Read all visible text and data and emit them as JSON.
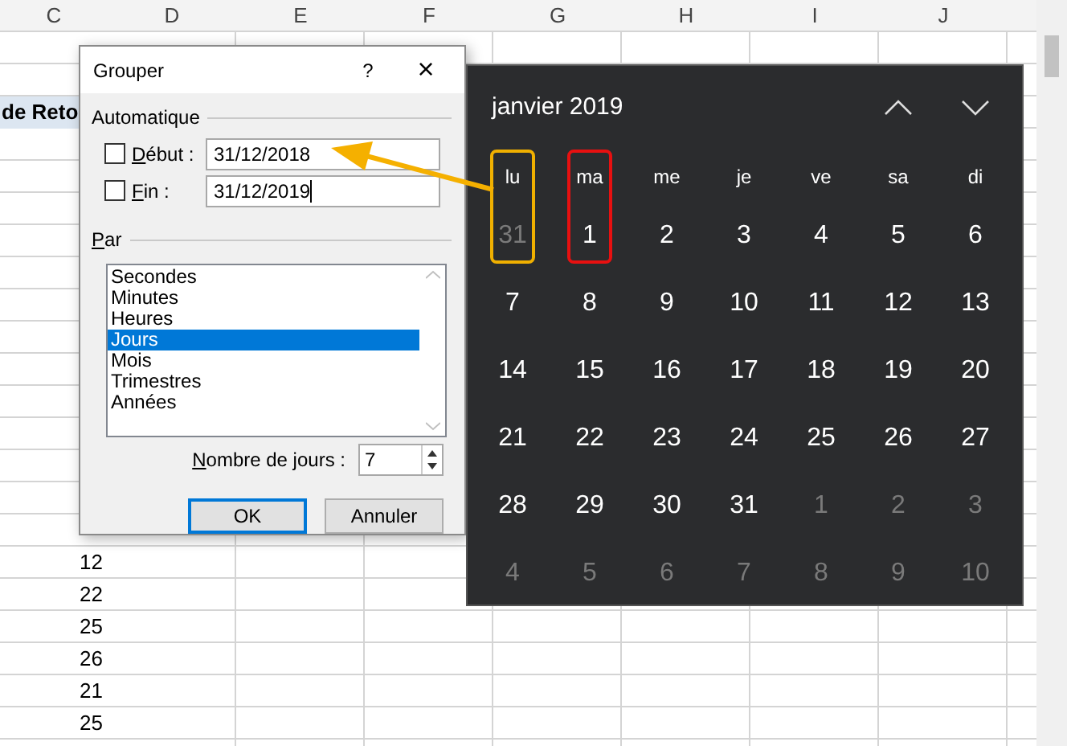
{
  "sheet": {
    "columns": [
      "C",
      "D",
      "E",
      "F",
      "G",
      "H",
      "I",
      "J"
    ],
    "rows": [
      {},
      {},
      {
        "column_c": "de Reto",
        "header_fill": true
      },
      {},
      {},
      {},
      {},
      {},
      {},
      {},
      {},
      {},
      {},
      {},
      {},
      {},
      {
        "column_c": "12"
      },
      {
        "column_c": "22"
      },
      {
        "column_c": "25"
      },
      {
        "column_c": "26"
      },
      {
        "column_c": "21"
      },
      {
        "column_c": "25"
      },
      {}
    ]
  },
  "dialog": {
    "title": "Grouper",
    "help": "?",
    "close": "×",
    "auto_group": {
      "label": "Automatique",
      "fields": [
        {
          "label": "Début :",
          "checked": false,
          "value": "31/12/2018",
          "caret": false
        },
        {
          "label": "Fin :",
          "checked": false,
          "value": "31/12/2019",
          "caret": true
        }
      ]
    },
    "by_group": {
      "label": "Par",
      "items": [
        {
          "label": "Secondes",
          "selected": false
        },
        {
          "label": "Minutes",
          "selected": false
        },
        {
          "label": "Heures",
          "selected": false
        },
        {
          "label": "Jours",
          "selected": true
        },
        {
          "label": "Mois",
          "selected": false
        },
        {
          "label": "Trimestres",
          "selected": false
        },
        {
          "label": "Années",
          "selected": false
        }
      ]
    },
    "days_count": {
      "label": "Nombre de jours :",
      "value": "7"
    },
    "buttons": [
      {
        "label": "OK",
        "default": true
      },
      {
        "label": "Annuler",
        "default": false
      }
    ]
  },
  "calendar": {
    "title": "janvier 2019",
    "weekdays": [
      {
        "label": "lu",
        "color": "#f0b000"
      },
      {
        "label": "ma",
        "color": "#e81010"
      },
      {
        "label": "me"
      },
      {
        "label": "je"
      },
      {
        "label": "ve"
      },
      {
        "label": "sa"
      },
      {
        "label": "di"
      }
    ],
    "weeks": [
      [
        {
          "label": "31",
          "in_month": false
        },
        {
          "label": "1",
          "in_month": true
        },
        {
          "label": "2",
          "in_month": true
        },
        {
          "label": "3",
          "in_month": true
        },
        {
          "label": "4",
          "in_month": true
        },
        {
          "label": "5",
          "in_month": true
        },
        {
          "label": "6",
          "in_month": true
        }
      ],
      [
        {
          "label": "7",
          "in_month": true
        },
        {
          "label": "8",
          "in_month": true
        },
        {
          "label": "9",
          "in_month": true
        },
        {
          "label": "10",
          "in_month": true
        },
        {
          "label": "11",
          "in_month": true
        },
        {
          "label": "12",
          "in_month": true
        },
        {
          "label": "13",
          "in_month": true
        }
      ],
      [
        {
          "label": "14",
          "in_month": true
        },
        {
          "label": "15",
          "in_month": true
        },
        {
          "label": "16",
          "in_month": true
        },
        {
          "label": "17",
          "in_month": true
        },
        {
          "label": "18",
          "in_month": true
        },
        {
          "label": "19",
          "in_month": true
        },
        {
          "label": "20",
          "in_month": true
        }
      ],
      [
        {
          "label": "21",
          "in_month": true
        },
        {
          "label": "22",
          "in_month": true
        },
        {
          "label": "23",
          "in_month": true
        },
        {
          "label": "24",
          "in_month": true
        },
        {
          "label": "25",
          "in_month": true
        },
        {
          "label": "26",
          "in_month": true
        },
        {
          "label": "27",
          "in_month": true
        }
      ],
      [
        {
          "label": "28",
          "in_month": true
        },
        {
          "label": "29",
          "in_month": true
        },
        {
          "label": "30",
          "in_month": true
        },
        {
          "label": "31",
          "in_month": true
        },
        {
          "label": "1",
          "in_month": false
        },
        {
          "label": "2",
          "in_month": false
        },
        {
          "label": "3",
          "in_month": false
        }
      ],
      [
        {
          "label": "4",
          "in_month": false
        },
        {
          "label": "5",
          "in_month": false
        },
        {
          "label": "6",
          "in_month": false
        },
        {
          "label": "7",
          "in_month": false
        },
        {
          "label": "8",
          "in_month": false
        },
        {
          "label": "9",
          "in_month": false
        },
        {
          "label": "10",
          "in_month": false
        }
      ]
    ]
  }
}
